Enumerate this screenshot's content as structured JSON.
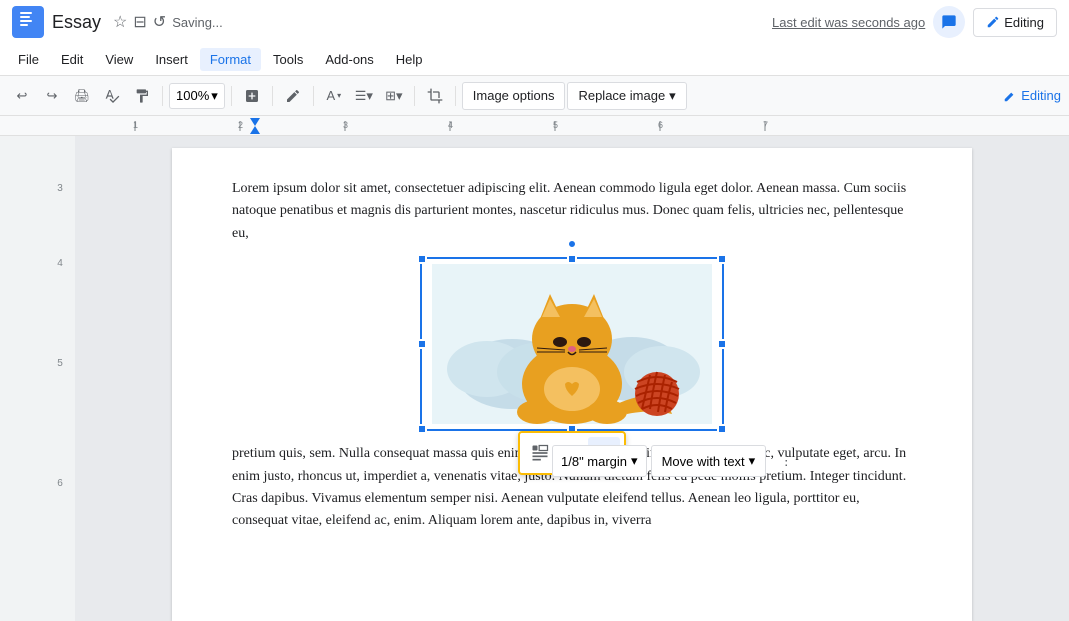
{
  "title_bar": {
    "app_icon_label": "Docs",
    "doc_title": "Essay",
    "saving_text": "Saving...",
    "last_edit": "Last edit was seconds ago",
    "editing_label": "Editing"
  },
  "menu_bar": {
    "items": [
      "File",
      "Edit",
      "View",
      "Insert",
      "Format",
      "Tools",
      "Add-ons",
      "Help"
    ]
  },
  "toolbar": {
    "zoom_level": "100%",
    "image_options_label": "Image options",
    "replace_image_label": "Replace image"
  },
  "document": {
    "text_before": "Lorem ipsum dolor sit amet, consectetuer adipiscing elit. Aenean commodo ligula eget dolor. Aenean massa. Cum sociis natoque penatibus et magnis dis parturient montes, nascetur ridiculus mus. Donec quam felis, ultricies nec, pellentesque eu,",
    "text_after": "pretium quis, sem. Nulla consequat massa quis enim. Donec pede justo, fringilla vel, aliquet nec, vulputate eget, arcu. In enim justo, rhoncus ut, imperdiet a, venenatis vitae, justo. Nullam dictum felis eu pede mollis pretium. Integer tincidunt. Cras dapibus. Vivamus elementum semper nisi. Aenean vulputate eleifend tellus. Aenean leo ligula, porttitor eu, consequat vitae, eleifend ac, enim. Aliquam lorem ante, dapibus in, viverra"
  },
  "image_toolbar": {
    "wrap_inline_label": "Wrap text inline",
    "wrap_left_label": "Wrap text left",
    "wrap_right_label": "Wrap text right",
    "margin_label": "1/8\" margin",
    "move_with_text_label": "Move with text"
  }
}
